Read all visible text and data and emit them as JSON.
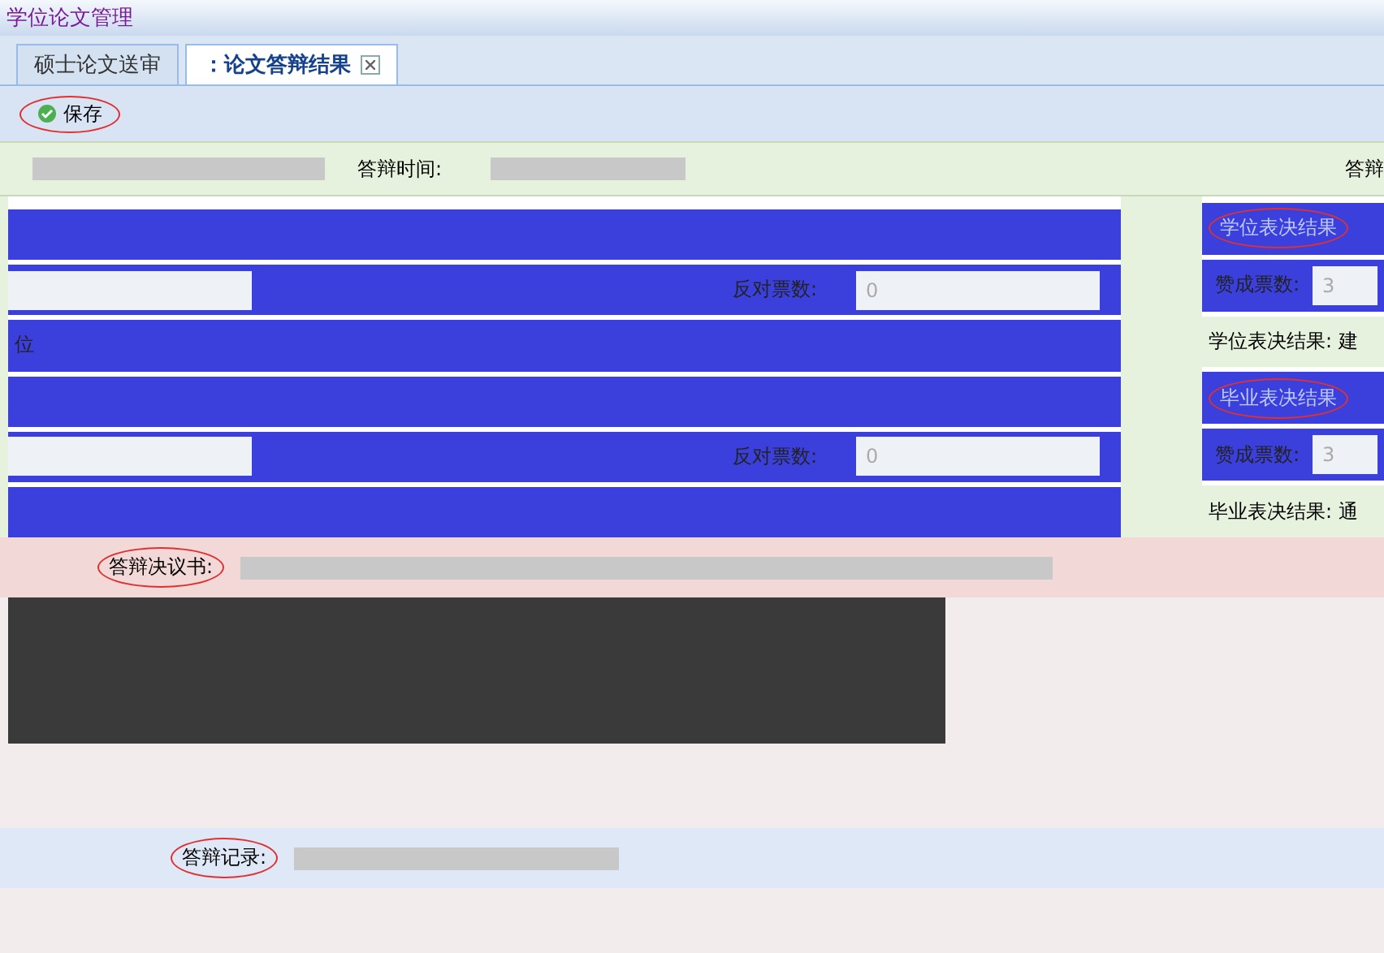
{
  "app_title": "学位论文管理",
  "tabs": [
    {
      "label": "硕士论文送审",
      "selected": false,
      "closable": false
    },
    {
      "label": "：论文答辩结果",
      "selected": true,
      "closable": true
    }
  ],
  "toolbar": [
    {
      "label": "保存",
      "highlighted": true
    }
  ],
  "info_row": {
    "time_label": "答辩时间:",
    "right_label": "答辩"
  },
  "left_panel": [
    {
      "kind": "blank"
    },
    {
      "kind": "vote",
      "label": "反对票数:",
      "value": "0",
      "disabled": true
    },
    {
      "kind": "text",
      "text": "位"
    },
    {
      "kind": "blank"
    },
    {
      "kind": "vote",
      "label": "反对票数:",
      "value": "0",
      "disabled": true
    },
    {
      "kind": "blank"
    }
  ],
  "right_panel": [
    {
      "kind": "heading",
      "label": "学位表决结果",
      "highlighted": true
    },
    {
      "kind": "field",
      "label": "赞成票数:",
      "value": "3",
      "disabled": true
    },
    {
      "kind": "result",
      "label": "学位表决结果:",
      "value": "建"
    },
    {
      "kind": "heading",
      "label": "毕业表决结果",
      "highlighted": true
    },
    {
      "kind": "field",
      "label": "赞成票数:",
      "value": "3",
      "disabled": true
    },
    {
      "kind": "result",
      "label": "毕业表决结果:",
      "value": "通"
    }
  ],
  "resolution": {
    "label": "答辩决议书:",
    "highlighted": true
  },
  "record": {
    "label": "答辩记录:",
    "highlighted": true
  }
}
